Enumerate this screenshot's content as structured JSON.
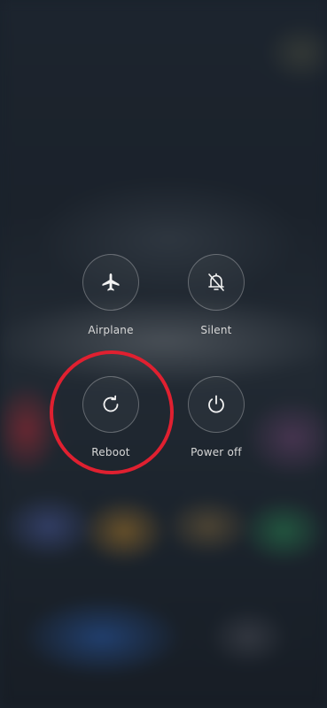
{
  "power_menu": {
    "items": [
      {
        "label": "Airplane",
        "icon": "airplane-icon"
      },
      {
        "label": "Silent",
        "icon": "bell-off-icon"
      },
      {
        "label": "Reboot",
        "icon": "reboot-icon"
      },
      {
        "label": "Power off",
        "icon": "power-icon"
      }
    ]
  },
  "annotation": {
    "highlight_color": "#e02030",
    "highlighted_item": "Reboot"
  }
}
